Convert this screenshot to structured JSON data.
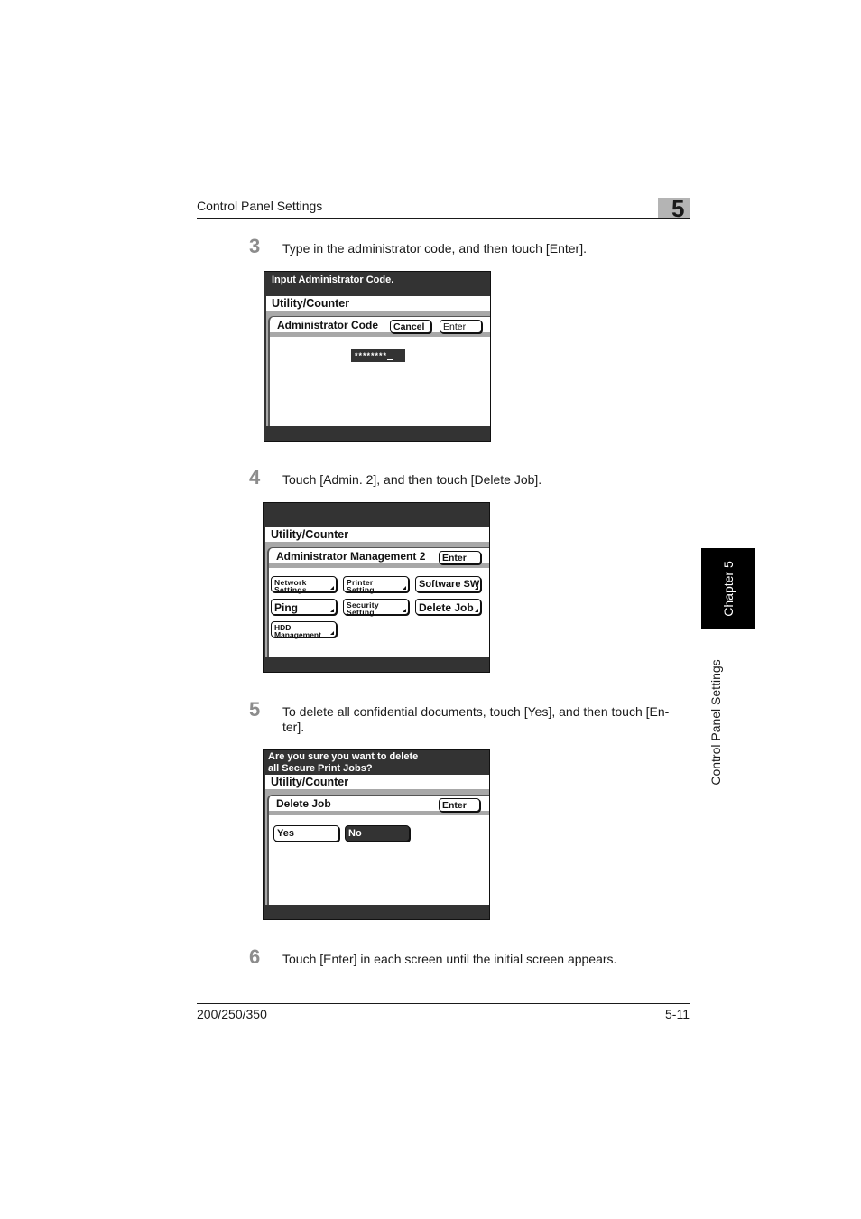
{
  "header": {
    "section_title": "Control Panel Settings",
    "chapter_number": "5"
  },
  "side_tab": {
    "chapter_label": "Chapter 5",
    "section_label": "Control Panel Settings"
  },
  "steps": [
    {
      "number": "3",
      "text": "Type in the administrator code, and then touch [Enter]."
    },
    {
      "number": "4",
      "text": "Touch [Admin. 2], and then touch [Delete Job]."
    },
    {
      "number": "5",
      "text": "To delete all confidential documents, touch [Yes], and then touch [En-ter]."
    },
    {
      "number": "6",
      "text": "Touch [Enter] in each screen until the initial screen appears."
    }
  ],
  "screens": {
    "admin_code": {
      "message": "Input Administrator Code.",
      "breadcrumb": "Utility/Counter",
      "card_title": "Administrator Code",
      "cancel_label": "Cancel",
      "enter_label": "Enter",
      "password_value": "********"
    },
    "admin_mgmt": {
      "message": "",
      "breadcrumb": "Utility/Counter",
      "card_title": "Administrator Management 2",
      "enter_label": "Enter",
      "buttons": [
        {
          "label_line1": "Network",
          "label_line2": "Settings"
        },
        {
          "label_line1": "Printer",
          "label_line2": "Setting"
        },
        {
          "label": "Software SW"
        },
        {
          "label": "Ping"
        },
        {
          "label_line1": "Security",
          "label_line2": "Setting"
        },
        {
          "label": "Delete Job"
        },
        {
          "label_line1": "HDD",
          "label_line2": "Management"
        }
      ]
    },
    "delete_job": {
      "message_line1": "Are you sure you want to delete",
      "message_line2": "all Secure Print Jobs?",
      "breadcrumb": "Utility/Counter",
      "card_title": "Delete Job",
      "enter_label": "Enter",
      "yes_label": "Yes",
      "no_label": "No",
      "selected": "No"
    }
  },
  "footer": {
    "model": "200/250/350",
    "page": "5-11"
  }
}
